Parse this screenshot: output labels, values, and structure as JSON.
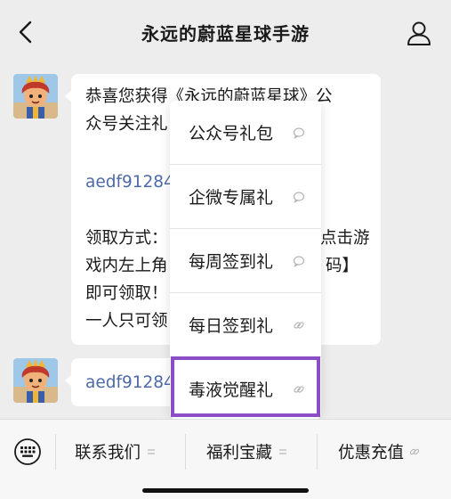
{
  "header": {
    "title": "永远的蔚蓝星球手游",
    "back_icon": "chevron-left-icon",
    "profile_icon": "person-icon"
  },
  "messages": [
    {
      "lines_visible": [
        "恭喜您获得《永远的蔚蓝星球》公",
        "众号关注礼",
        "aedf91284",
        "领取方式：",
        "点击游",
        "戏内左上角",
        "码】",
        "即可领取！",
        "一人只可领"
      ]
    },
    {
      "text_visible": "aedf91284"
    }
  ],
  "menu": {
    "items": [
      {
        "label": "公众号礼包",
        "icon": "chat-bubble-icon"
      },
      {
        "label": "企微专属礼",
        "icon": "chat-bubble-icon"
      },
      {
        "label": "每周签到礼",
        "icon": "chat-bubble-icon"
      },
      {
        "label": "每日签到礼",
        "icon": "link-icon"
      },
      {
        "label": "毒液觉醒礼",
        "icon": "link-icon"
      }
    ],
    "highlight_color": "#8c4ec6"
  },
  "bottom_menu": {
    "keyboard_icon": "keyboard-icon",
    "items": [
      {
        "label": "联系我们",
        "icon": "menu-lines-icon"
      },
      {
        "label": "福利宝藏",
        "icon": "menu-lines-icon"
      },
      {
        "label": "优惠充值",
        "icon": "link-icon"
      }
    ]
  },
  "colors": {
    "background": "#ededed",
    "bubble": "#ffffff",
    "link": "#4d6aa8"
  }
}
